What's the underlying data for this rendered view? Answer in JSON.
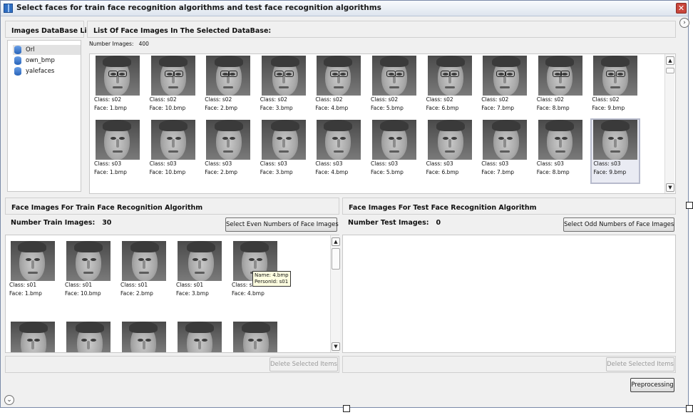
{
  "window": {
    "title": "Select faces for train face recognition algorithms and test face recognition algorithms",
    "close_glyph": "✕"
  },
  "nav": {
    "expand_glyph": "›",
    "collapse_glyph": "⌄"
  },
  "db_list": {
    "header": "Images DataBase List:",
    "items": [
      {
        "label": "Orl",
        "selected": true
      },
      {
        "label": "own_bmp",
        "selected": false
      },
      {
        "label": "yalefaces",
        "selected": false
      }
    ]
  },
  "face_list": {
    "header": "List Of Face Images In The Selected DataBase:",
    "count_label": "Number Images:",
    "count_value": "400",
    "row1": [
      {
        "cls": "Class: s02",
        "face": "Face: 1.bmp"
      },
      {
        "cls": "Class: s02",
        "face": "Face: 10.bmp"
      },
      {
        "cls": "Class: s02",
        "face": "Face: 2.bmp"
      },
      {
        "cls": "Class: s02",
        "face": "Face: 3.bmp"
      },
      {
        "cls": "Class: s02",
        "face": "Face: 4.bmp"
      },
      {
        "cls": "Class: s02",
        "face": "Face: 5.bmp"
      },
      {
        "cls": "Class: s02",
        "face": "Face: 6.bmp"
      },
      {
        "cls": "Class: s02",
        "face": "Face: 7.bmp"
      },
      {
        "cls": "Class: s02",
        "face": "Face: 8.bmp"
      },
      {
        "cls": "Class: s02",
        "face": "Face: 9.bmp"
      }
    ],
    "row2": [
      {
        "cls": "Class: s03",
        "face": "Face: 1.bmp"
      },
      {
        "cls": "Class: s03",
        "face": "Face: 10.bmp"
      },
      {
        "cls": "Class: s03",
        "face": "Face: 2.bmp"
      },
      {
        "cls": "Class: s03",
        "face": "Face: 3.bmp"
      },
      {
        "cls": "Class: s03",
        "face": "Face: 4.bmp"
      },
      {
        "cls": "Class: s03",
        "face": "Face: 5.bmp"
      },
      {
        "cls": "Class: s03",
        "face": "Face: 6.bmp"
      },
      {
        "cls": "Class: s03",
        "face": "Face: 7.bmp"
      },
      {
        "cls": "Class: s03",
        "face": "Face: 8.bmp"
      },
      {
        "cls": "Class: s03",
        "face": "Face: 9.bmp"
      }
    ]
  },
  "train": {
    "header": "Face Images For Train Face Recognition Algorithm",
    "count_label": "Number Train Images:",
    "count_value": "30",
    "select_button": "Select Even Numbers of Face Images",
    "delete_button": "Delete Selected Items",
    "items": [
      {
        "cls": "Class: s01",
        "face": "Face: 1.bmp"
      },
      {
        "cls": "Class: s01",
        "face": "Face: 10.bmp"
      },
      {
        "cls": "Class: s01",
        "face": "Face: 2.bmp"
      },
      {
        "cls": "Class: s01",
        "face": "Face: 3.bmp"
      },
      {
        "cls": "Class: s01",
        "face": "Face: 4.bmp"
      }
    ],
    "tooltip": {
      "name": "Name: 4.bmp",
      "person": "PersonId: s01"
    }
  },
  "test": {
    "header": "Face Images For Test Face Recognition Algorithm",
    "count_label": "Number Test Images:",
    "count_value": "0",
    "select_button": "Select Odd Numbers of Face Images",
    "delete_button": "Delete Selected Items"
  },
  "footer": {
    "preprocessing_button": "Preprocessing"
  },
  "icons": {
    "scroll_up": "▲",
    "scroll_down": "▼"
  }
}
